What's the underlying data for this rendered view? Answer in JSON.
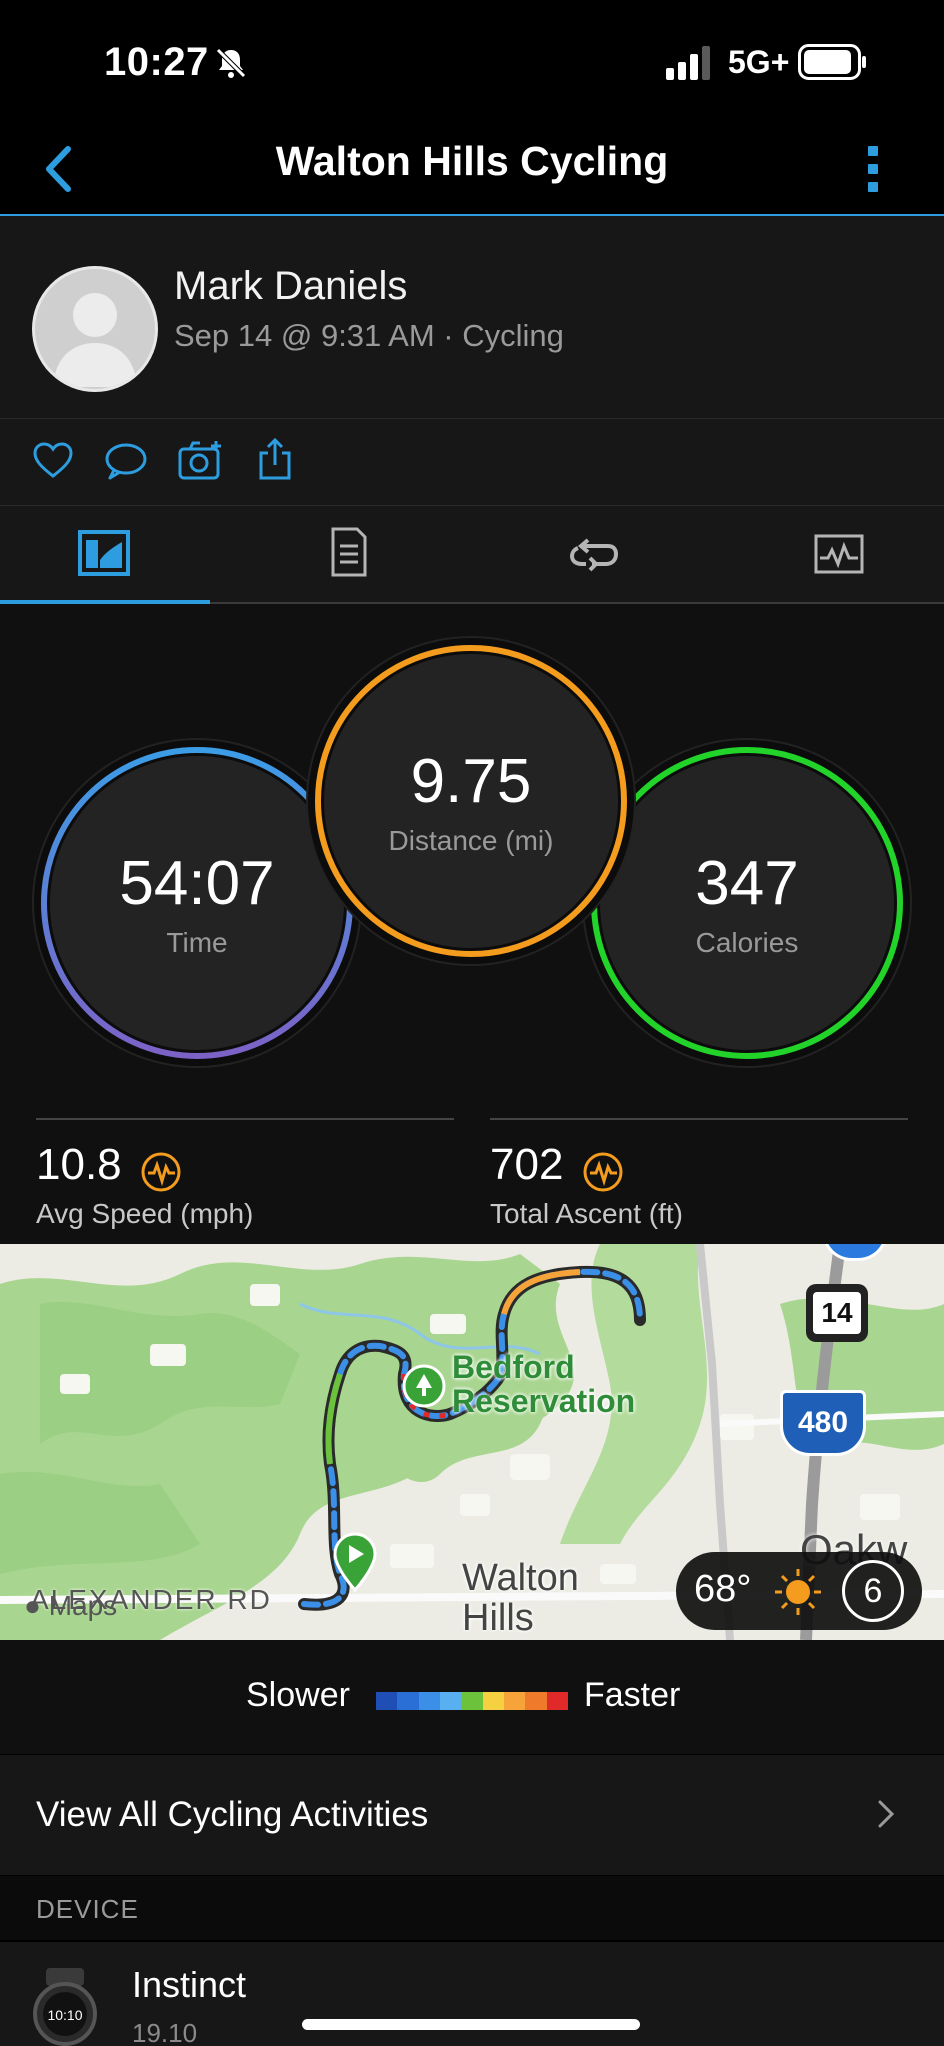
{
  "status_bar": {
    "time": "10:27",
    "network": "5G+"
  },
  "nav": {
    "title": "Walton Hills Cycling"
  },
  "profile": {
    "name": "Mark Daniels",
    "subtitle": "Sep 14 @ 9:31 AM · Cycling"
  },
  "stats": {
    "time": {
      "value": "54:07",
      "label": "Time"
    },
    "distance": {
      "value": "9.75",
      "label": "Distance (mi)"
    },
    "calories": {
      "value": "347",
      "label": "Calories"
    },
    "avg_speed": {
      "value": "10.8",
      "label": "Avg Speed (mph)"
    },
    "total_ascent": {
      "value": "702",
      "label": "Total Ascent (ft)"
    }
  },
  "map": {
    "place_label": "Bedford\nReservation",
    "place_label_line1": "Bedford",
    "place_label_line2": "Reservation",
    "town_label_line1": "Walton",
    "town_label_line2": "Hills",
    "road_label": "ALEXANDER RD",
    "attribution": "Maps",
    "highway_14": "14",
    "interstate_480": "480",
    "edge_label": "Oakw",
    "weather_temp": "68°",
    "weather_wind": "6"
  },
  "legend": {
    "slower": "Slower",
    "faster": "Faster",
    "colors": [
      "#1f4fb5",
      "#2a6fd6",
      "#3b8fe6",
      "#58b0f0",
      "#6cc23a",
      "#f5d142",
      "#f6a33a",
      "#ef7a2c",
      "#e02a2a"
    ]
  },
  "view_all": {
    "label": "View All Cycling Activities"
  },
  "device_section": {
    "header": "DEVICE",
    "name": "Instinct",
    "subtext": "19.10"
  },
  "colors": {
    "accent": "#2e9de0",
    "time_ring": "#3f8ee0",
    "distance_ring": "#f39c1e",
    "calories_ring": "#22d32a",
    "icon_orange": "#f39c1e"
  }
}
